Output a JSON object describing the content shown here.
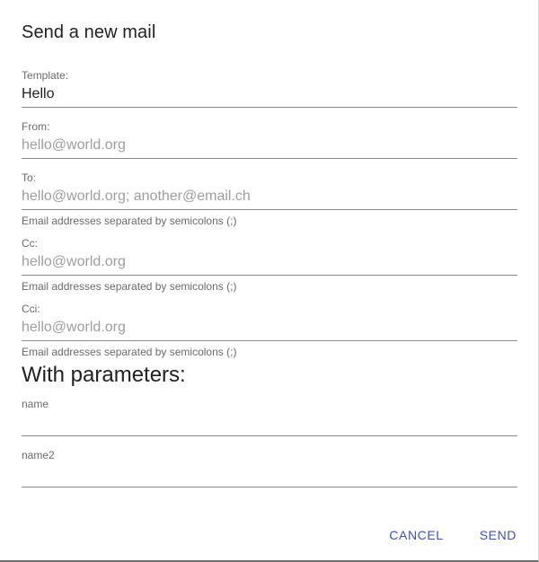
{
  "dialog": {
    "title": "Send a new mail"
  },
  "fields": {
    "template": {
      "label": "Template:",
      "value": "Hello"
    },
    "from": {
      "label": "From:",
      "placeholder": "hello@world.org"
    },
    "to": {
      "label": "To:",
      "placeholder": "hello@world.org; another@email.ch",
      "helper": "Email addresses separated by semicolons (;)"
    },
    "cc": {
      "label": "Cc:",
      "placeholder": "hello@world.org",
      "helper": "Email addresses separated by semicolons (;)"
    },
    "cci": {
      "label": "Cci:",
      "placeholder": "hello@world.org",
      "helper": "Email addresses separated by semicolons (;)"
    }
  },
  "parameters": {
    "heading": "With parameters:",
    "items": [
      {
        "label": "name",
        "value": ""
      },
      {
        "label": "name2",
        "value": ""
      }
    ]
  },
  "actions": {
    "cancel_label": "CANCEL",
    "send_label": "SEND"
  },
  "colors": {
    "accent": "#3f51b5",
    "text": "#212121",
    "placeholder": "#9e9e9e",
    "label": "#6b6b6b"
  }
}
